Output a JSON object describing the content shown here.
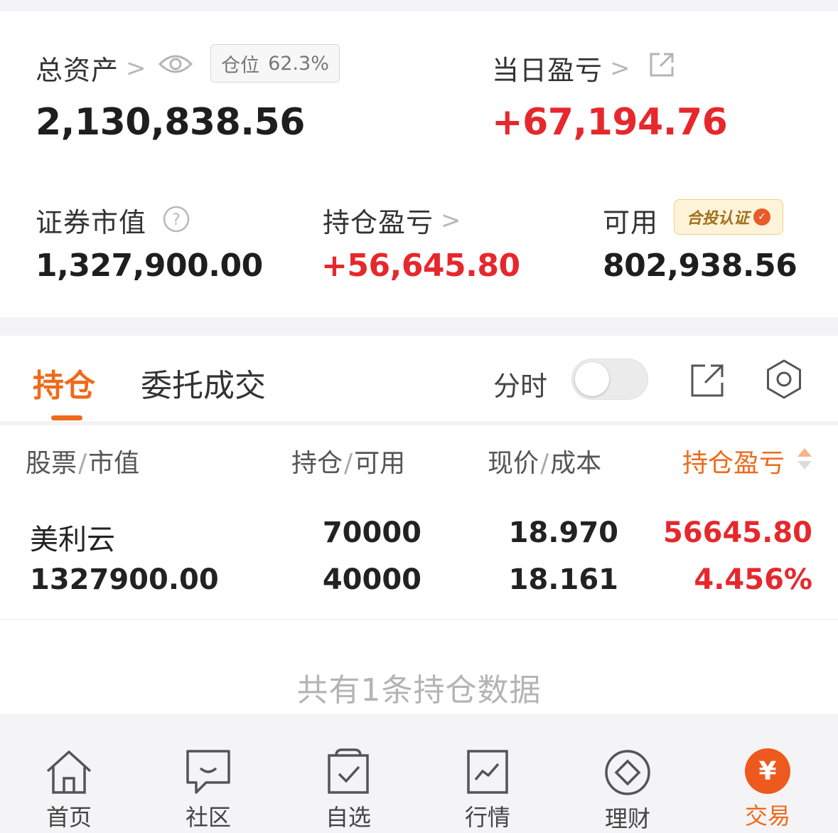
{
  "summary": {
    "total_assets_label": "总资产",
    "total_assets_value": "2,130,838.56",
    "position_label": "仓位",
    "position_value": "62.3%",
    "daily_pnl_label": "当日盈亏",
    "daily_pnl_value": "+67,194.76",
    "market_value_label": "证券市值",
    "market_value_value": "1,327,900.00",
    "holding_pnl_label": "持仓盈亏",
    "holding_pnl_value": "+56,645.80",
    "available_label": "可用",
    "available_value": "802,938.56",
    "cert_badge": "合投认证",
    "chevron": ">"
  },
  "holdings": {
    "tabs": [
      {
        "label": "持仓",
        "active": true
      },
      {
        "label": "委托成交",
        "active": false
      }
    ],
    "toggle_label": "分时",
    "toggle_on": false,
    "columns": [
      {
        "main": "股票",
        "sub": "市值"
      },
      {
        "main": "持仓",
        "sub": "可用"
      },
      {
        "main": "现价",
        "sub": "成本"
      },
      {
        "main": "持仓盈亏",
        "sub": ""
      }
    ],
    "rows": [
      {
        "name": "美利云",
        "market_value": "1327900.00",
        "position": "70000",
        "available": "40000",
        "price": "18.970",
        "cost": "18.161",
        "pnl": "56645.80",
        "pnl_pct": "4.456%"
      }
    ],
    "footer_note": "共有1条持仓数据"
  },
  "nav": {
    "items": [
      {
        "label": "首页",
        "icon": "home-icon",
        "active": false
      },
      {
        "label": "社区",
        "icon": "community-icon",
        "active": false
      },
      {
        "label": "自选",
        "icon": "watchlist-icon",
        "active": false
      },
      {
        "label": "行情",
        "icon": "market-icon",
        "active": false
      },
      {
        "label": "理财",
        "icon": "wealth-icon",
        "active": false
      },
      {
        "label": "交易",
        "icon": "trade-icon",
        "active": true
      }
    ],
    "trade_symbol": "¥"
  },
  "colors": {
    "accent": "#ee6a1a",
    "gain": "#e6282d"
  }
}
